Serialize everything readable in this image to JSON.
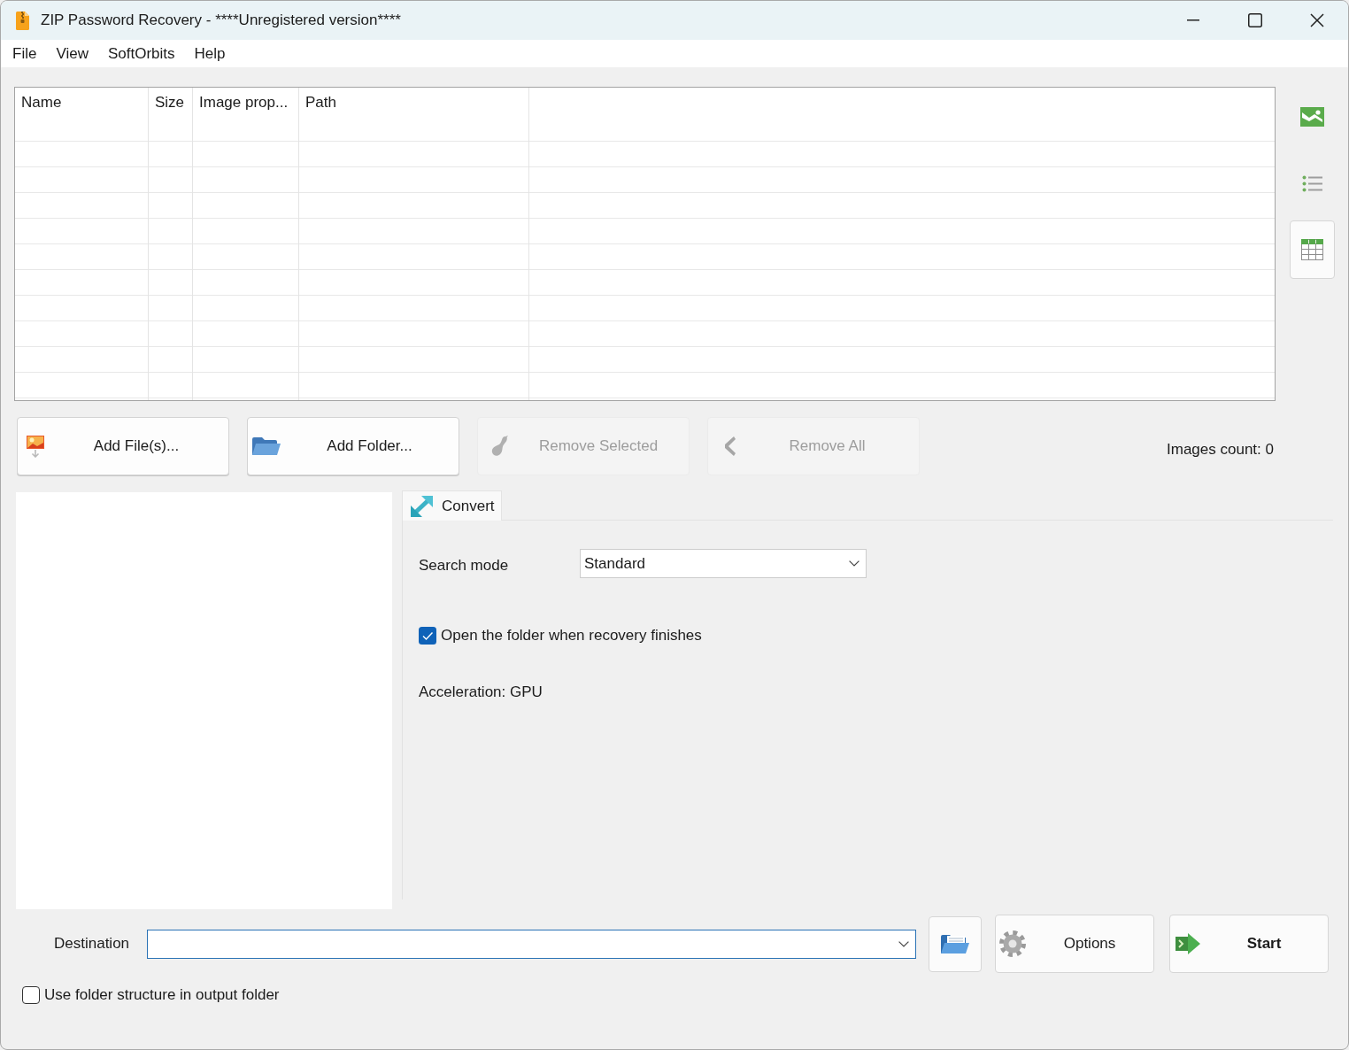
{
  "window": {
    "title": "ZIP Password Recovery - ****Unregistered version****"
  },
  "menu": [
    {
      "label": "File"
    },
    {
      "label": "View"
    },
    {
      "label": "SoftOrbits"
    },
    {
      "label": "Help"
    }
  ],
  "file_list": {
    "columns": [
      "Name",
      "Size",
      "Image prop...",
      "Path"
    ]
  },
  "view_buttons": [
    {
      "kind": "thumbnails",
      "selected": false
    },
    {
      "kind": "list",
      "selected": false
    },
    {
      "kind": "table",
      "selected": true
    }
  ],
  "file_buttons": [
    {
      "kind": "add_files",
      "label": "Add File(s)...",
      "disabled": false
    },
    {
      "kind": "add_folder",
      "label": "Add Folder...",
      "disabled": false
    },
    {
      "kind": "remove_selected",
      "label": "Remove Selected",
      "disabled": true
    },
    {
      "kind": "remove_all",
      "label": "Remove All",
      "disabled": true
    }
  ],
  "images_count": "Images count: 0",
  "tabs": [
    {
      "label": "Convert",
      "selected": true
    }
  ],
  "convert": {
    "search_mode": {
      "label": "Search mode",
      "value": "Standard"
    },
    "open_folder": {
      "label": "Open the folder when recovery finishes",
      "checked": true
    },
    "acceleration": "Acceleration: GPU"
  },
  "destination": {
    "label": "Destination"
  },
  "action_buttons": [
    {
      "kind": "browse"
    },
    {
      "kind": "options",
      "label": "Options"
    },
    {
      "kind": "start",
      "label": "Start"
    }
  ],
  "folder_structure": {
    "label": "Use folder structure in output folder",
    "checked": false
  }
}
